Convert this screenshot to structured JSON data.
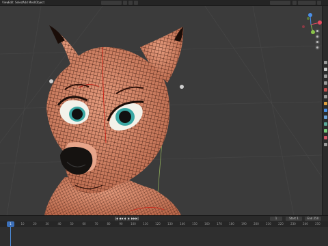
{
  "menubar": {
    "items": [
      "View",
      "Edit",
      "Select",
      "Add",
      "Mesh",
      "Object"
    ],
    "mode": "Edit Mode",
    "pivot": "Global"
  },
  "viewport": {
    "subject": "3D fox character head mesh with wireframe overlay"
  },
  "gizmo": {
    "axes": [
      "X",
      "Y",
      "Z"
    ],
    "colors": {
      "x": "#e84a5f",
      "y": "#8bc34a",
      "z": "#4a8fe8"
    }
  },
  "timeline": {
    "current_frame": "1",
    "start_label": "Start",
    "start_value": "1",
    "end_label": "End",
    "end_value": "250",
    "ticks": [
      "0",
      "10",
      "20",
      "30",
      "40",
      "50",
      "60",
      "70",
      "80",
      "90",
      "100",
      "110",
      "120",
      "130",
      "140",
      "150",
      "160",
      "170",
      "180",
      "190",
      "200",
      "210",
      "220",
      "230",
      "240",
      "250"
    ]
  },
  "icons": {
    "playback": [
      "jump-start-icon",
      "prev-key-icon",
      "play-reverse-icon",
      "play-icon",
      "next-key-icon",
      "jump-end-icon"
    ]
  }
}
